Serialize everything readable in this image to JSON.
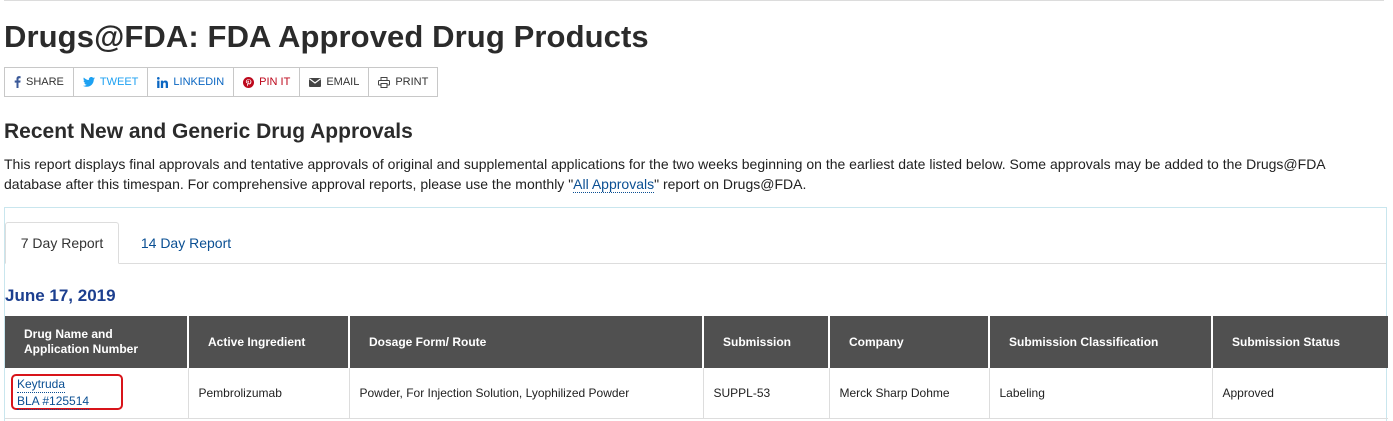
{
  "page": {
    "title": "Drugs@FDA: FDA Approved Drug Products"
  },
  "share_bar": [
    {
      "label": "SHARE",
      "icon": "facebook-icon",
      "color": "#3b5998"
    },
    {
      "label": "TWEET",
      "icon": "twitter-icon",
      "color": "#1da1f2"
    },
    {
      "label": "LINKEDIN",
      "icon": "linkedin-icon",
      "color": "#0a66c2"
    },
    {
      "label": "PIN IT",
      "icon": "pinterest-icon",
      "color": "#bd081c"
    },
    {
      "label": "EMAIL",
      "icon": "envelope-icon",
      "color": "#333333"
    },
    {
      "label": "PRINT",
      "icon": "printer-icon",
      "color": "#333333"
    }
  ],
  "section": {
    "title": "Recent New and Generic Drug Approvals",
    "intro_before": "This report displays final approvals and tentative approvals of original and supplemental applications for the two weeks beginning on the earliest date listed below. Some approvals may be added to the Drugs@FDA database after this timespan. For comprehensive approval reports, please use the monthly \"",
    "intro_link": "All Approvals",
    "intro_after": "\" report on Drugs@FDA."
  },
  "tabs": [
    {
      "label": "7 Day Report",
      "active": true
    },
    {
      "label": "14 Day Report",
      "active": false
    }
  ],
  "report": {
    "date": "June 17, 2019",
    "columns": [
      "Drug Name and Application Number",
      "Active Ingredient",
      "Dosage Form/ Route",
      "Submission",
      "Company",
      "Submission Classification",
      "Submission Status"
    ],
    "rows": [
      {
        "drug_name": "Keytruda",
        "application_number": "BLA #125514",
        "active_ingredient": "Pembrolizumab",
        "dosage_form_route": "Powder, For Injection Solution, Lyophilized Powder",
        "submission": "SUPPL-53",
        "company": "Merck Sharp Dohme",
        "classification": "Labeling",
        "status": "Approved"
      }
    ]
  },
  "colors": {
    "link": "#0a4f93",
    "date_heading": "#1c3f8f",
    "table_header_bg": "#505050",
    "highlight_box": "#d8141a"
  }
}
